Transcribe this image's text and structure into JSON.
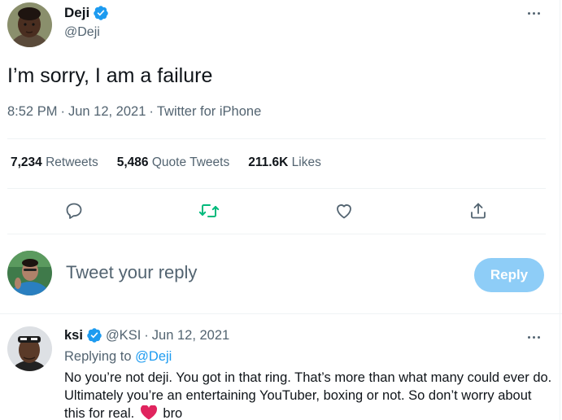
{
  "tweet": {
    "author": {
      "name": "Deji",
      "handle": "@Deji"
    },
    "text": "I’m sorry, I am a failure",
    "time": "8:52 PM",
    "date": "Jun 12, 2021",
    "source": "Twitter for iPhone",
    "meta_sep": "·"
  },
  "stats": {
    "retweets": {
      "count": "7,234",
      "label": "Retweets"
    },
    "quote_tweets": {
      "count": "5,486",
      "label": "Quote Tweets"
    },
    "likes": {
      "count": "211.6K",
      "label": "Likes"
    }
  },
  "actions": {
    "icons": [
      "reply-icon",
      "retweet-icon",
      "like-icon",
      "share-icon"
    ],
    "retweet_color": "#00ba7c",
    "icon_color": "#536471"
  },
  "reply_box": {
    "placeholder": "Tweet your reply",
    "button_label": "Reply",
    "button_color": "#8ecdf7"
  },
  "reply": {
    "name": "ksi",
    "handle": "@KSI",
    "sep": "·",
    "date": "Jun 12, 2021",
    "replying_prefix": "Replying to",
    "replying_to": "@Deji",
    "text_before": "No you’re not deji. You got in that ring. That’s more than what many could ever do. Ultimately you’re an entertaining YouTuber, boxing or not. So don’t worry about this for real.",
    "text_after": "bro"
  },
  "colors": {
    "verified_blue": "#1d9bf0",
    "heart_red": "#e0245e",
    "secondary_text": "#536471"
  }
}
